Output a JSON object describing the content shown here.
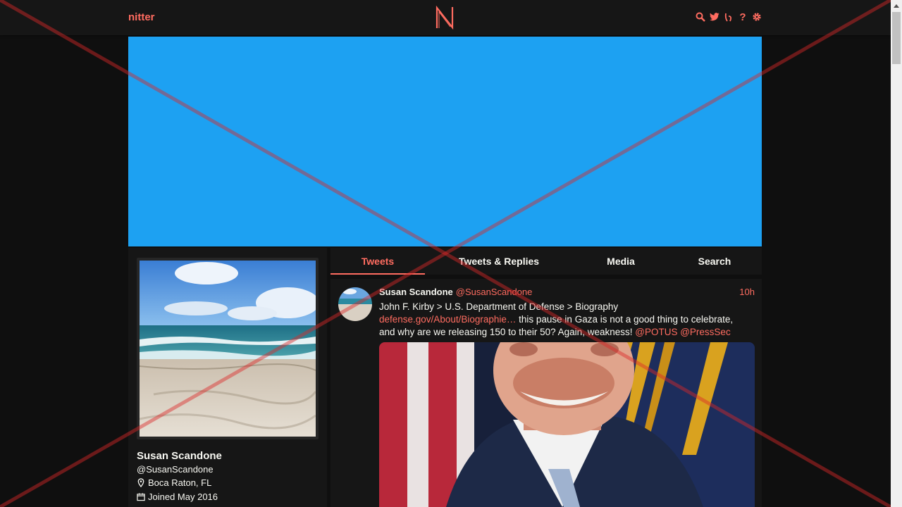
{
  "nav": {
    "site_name": "nitter",
    "help_symbol": "?"
  },
  "colors": {
    "accent": "#ff6c60",
    "banner": "#1da1f2",
    "background": "#0f0f0f",
    "panel": "#161616"
  },
  "profile": {
    "fullname": "Susan Scandone",
    "username": "@SusanScandone",
    "location": "Boca Raton, FL",
    "joined": "Joined May 2016"
  },
  "tabs": [
    {
      "label": "Tweets",
      "active": true
    },
    {
      "label": "Tweets & Replies",
      "active": false
    },
    {
      "label": "Media",
      "active": false
    },
    {
      "label": "Search",
      "active": false
    }
  ],
  "tweet": {
    "fullname": "Susan Scandone",
    "username": "@SusanScandone",
    "date": "10h",
    "text_line1": "John F. Kirby > U.S. Department of Defense > Biography",
    "link": "defense.gov/About/Biographie…",
    "text_after_link": " this pause in Gaza is not a good thing to celebrate,",
    "text_line3": "and why are we releasing 150 to their 50? Again, weakness! ",
    "mention1": "@POTUS",
    "mention2": "@PressSec"
  },
  "icons": [
    "search-icon",
    "twitter-bird-icon",
    "rss-icon",
    "help-icon",
    "gear-icon",
    "map-pin-icon",
    "calendar-icon"
  ]
}
